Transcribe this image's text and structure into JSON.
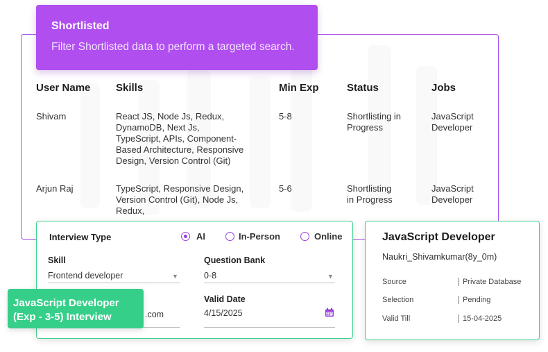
{
  "banner": {
    "title": "Shortlisted",
    "subtitle": "Filter Shortlisted data to perform a targeted search."
  },
  "table": {
    "headers": [
      "User Name",
      "Skills",
      "Min Exp",
      "Status",
      "Jobs"
    ],
    "rows": [
      {
        "user": "Shivam",
        "skills": [
          "React JS, Node Js, Redux,",
          "DynamoDB, Next Js,",
          "TypeScript, APIs, Component-",
          "Based Architecture, Responsive",
          "Design, Version Control (Git)"
        ],
        "min_exp": "5-8",
        "status": [
          "Shortlisting in",
          "Progress"
        ],
        "jobs": [
          "JavaScript",
          "Developer"
        ]
      },
      {
        "user": "Arjun Raj",
        "skills": [
          "TypeScript, Responsive Design,",
          "Version Control (Git),  Node Js,",
          "Redux,"
        ],
        "min_exp": "5-6",
        "status": [
          "Shortlisting",
          "in Progress"
        ],
        "jobs": [
          "JavaScript",
          "Developer"
        ]
      }
    ]
  },
  "form": {
    "interview_type_label": "Interview Type",
    "options": [
      {
        "label": "AI",
        "selected": true
      },
      {
        "label": "In-Person",
        "selected": false
      },
      {
        "label": "Online",
        "selected": false
      }
    ],
    "skill_label": "Skill",
    "skill_value": "Frontend developer",
    "question_bank_label": "Question Bank",
    "question_bank_value": "0-8",
    "valid_date_label": "Valid Date",
    "valid_date_value": "4/15/2025",
    "partial_value": ".com"
  },
  "green_banner": {
    "line1": "JavaScript Developer",
    "line2": "(Exp - 3-5) Interview"
  },
  "job_card": {
    "title": "JavaScript Developer",
    "subtitle": "Naukri_Shivamkumar(8y_0m)",
    "fields": [
      {
        "key": "Source",
        "value": "Private Database"
      },
      {
        "key": "Selection",
        "value": "Pending"
      },
      {
        "key": "Valid Till",
        "value": "15-04-2025"
      }
    ]
  },
  "colors": {
    "purple": "#b04ef0",
    "green": "#36cf8a",
    "radio": "#9b3fdc"
  },
  "icons": [
    "chevron-down-icon",
    "calendar-icon"
  ]
}
